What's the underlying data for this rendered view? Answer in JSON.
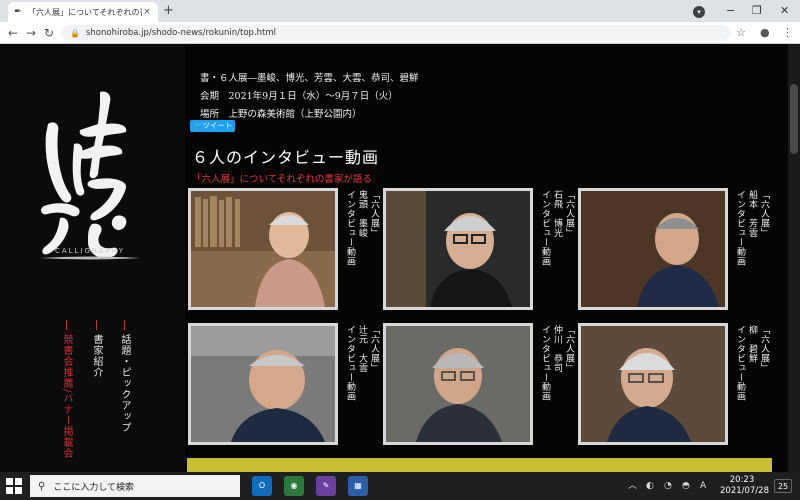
{
  "browser": {
    "tab_title": "「六人展」についてそれぞれの書家が語",
    "tab_close": "×",
    "new_tab": "+",
    "url": "shonohiroba.jp/shodo-news/rokunin/top.html",
    "window_controls": [
      "−",
      "❐",
      "✕"
    ]
  },
  "site": {
    "logo_text": "書のひろば",
    "logo_sub": "CALLIGRAPHY",
    "nav": [
      {
        "label": "話題・ピックアップ",
        "color": "white"
      },
      {
        "label": "書家紹介",
        "color": "white"
      },
      {
        "label": "競書会推薦/バナー掲載会",
        "color": "red"
      }
    ]
  },
  "exhibition": {
    "line1": "書・６人展―墨峻、博光、芳雲、大雲、恭司、碧鮮",
    "line2": "会期　2021年9月１日（水）～9月７日（火）",
    "line3": "場所　上野の森美術館（上野公園内）",
    "tweet": "ツイート"
  },
  "section": {
    "title": "６人のインタビュー動画",
    "subtitle": "「六人展」についてそれぞれの書家が語る"
  },
  "videos": [
    {
      "caption1": "「六人展」",
      "caption2": "インタビュー動画",
      "name": "鬼頭　墨峻"
    },
    {
      "caption1": "「六人展」",
      "caption2": "インタビュー動画",
      "name": "石飛　博光"
    },
    {
      "caption1": "「六人展」",
      "caption2": "インタビュー動画",
      "name": "船本　芳雲"
    },
    {
      "caption1": "「六人展」",
      "caption2": "インタビュー動画",
      "name": "辻元　大雲"
    },
    {
      "caption1": "「六人展」",
      "caption2": "インタビュー動画",
      "name": "仲川　恭司"
    },
    {
      "caption1": "「六人展」",
      "caption2": "インタビュー動画",
      "name": "柳　碧鮮"
    }
  ],
  "taskbar": {
    "search_placeholder": "ここに入力して検索",
    "time": "20:23",
    "date": "2021/07/28",
    "notif_count": "25",
    "lang": "A"
  },
  "colors": {
    "accent_red": "#e23c3c",
    "yellow_bar": "#c8be32",
    "twitter": "#1da1f2"
  }
}
